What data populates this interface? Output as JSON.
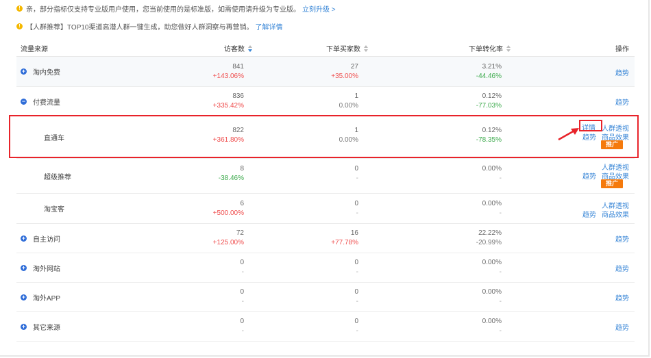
{
  "notices": [
    {
      "text": "亲，部分指标仅支持专业版用户使用，您当前使用的是标准版，如需使用请升级为专业版。",
      "link": "立刻升级 >"
    },
    {
      "text": "【人群推荐】TOP10渠道高潜人群一键生成，助您做好人群洞察与再营销。",
      "link": "了解详情"
    }
  ],
  "headers": {
    "source": "流量来源",
    "visitors": "访客数",
    "buyers": "下单买家数",
    "conversion": "下单转化率",
    "ops": "操作"
  },
  "rows": [
    {
      "name": "淘内免费",
      "toggle": "+",
      "visitors": "841",
      "visitors_change": "+143.06%",
      "buyers": "27",
      "buyers_change": "+35.00%",
      "conv": "3.21%",
      "conv_change": "-44.46%",
      "ops": {
        "trend": "趋势"
      }
    },
    {
      "name": "付费流量",
      "toggle": "−",
      "visitors": "836",
      "visitors_change": "+335.42%",
      "buyers": "1",
      "buyers_change": "0.00%",
      "conv": "0.12%",
      "conv_change": "-77.03%",
      "ops": {
        "trend": "趋势"
      }
    },
    {
      "name": "直通车",
      "visitors": "822",
      "visitors_change": "+361.80%",
      "buyers": "1",
      "buyers_change": "0.00%",
      "conv": "0.12%",
      "conv_change": "-78.35%",
      "ops": {
        "detail": "详情",
        "crowd": "人群透视",
        "trend": "趋势",
        "goods": "商品效果",
        "promote": "推广"
      }
    },
    {
      "name": "超级推荐",
      "visitors": "8",
      "visitors_change": "-38.46%",
      "buyers": "0",
      "buyers_change": "-",
      "conv": "0.00%",
      "conv_change": "-",
      "ops": {
        "crowd": "人群透视",
        "trend": "趋势",
        "goods": "商品效果",
        "promote": "推广"
      }
    },
    {
      "name": "淘宝客",
      "visitors": "6",
      "visitors_change": "+500.00%",
      "buyers": "0",
      "buyers_change": "-",
      "conv": "0.00%",
      "conv_change": "-",
      "ops": {
        "crowd": "人群透视",
        "trend": "趋势",
        "goods": "商品效果"
      }
    },
    {
      "name": "自主访问",
      "toggle": "+",
      "visitors": "72",
      "visitors_change": "+125.00%",
      "buyers": "16",
      "buyers_change": "+77.78%",
      "conv": "22.22%",
      "conv_change": "-20.99%",
      "ops": {
        "trend": "趋势"
      }
    },
    {
      "name": "淘外网站",
      "toggle": "+",
      "visitors": "0",
      "visitors_change": "-",
      "buyers": "0",
      "buyers_change": "-",
      "conv": "0.00%",
      "conv_change": "-",
      "ops": {
        "trend": "趋势"
      }
    },
    {
      "name": "淘外APP",
      "toggle": "+",
      "visitors": "0",
      "visitors_change": "-",
      "buyers": "0",
      "buyers_change": "-",
      "conv": "0.00%",
      "conv_change": "-",
      "ops": {
        "trend": "趋势"
      }
    },
    {
      "name": "其它来源",
      "toggle": "+",
      "visitors": "0",
      "visitors_change": "-",
      "buyers": "0",
      "buyers_change": "-",
      "conv": "0.00%",
      "conv_change": "-",
      "ops": {
        "trend": "趋势"
      }
    }
  ],
  "colors": {
    "positive": "#ef4c4c",
    "negative": "#3aa94a",
    "link": "#3a87d7",
    "promote_button": "#f57a0c",
    "highlight": "#e8232a"
  }
}
